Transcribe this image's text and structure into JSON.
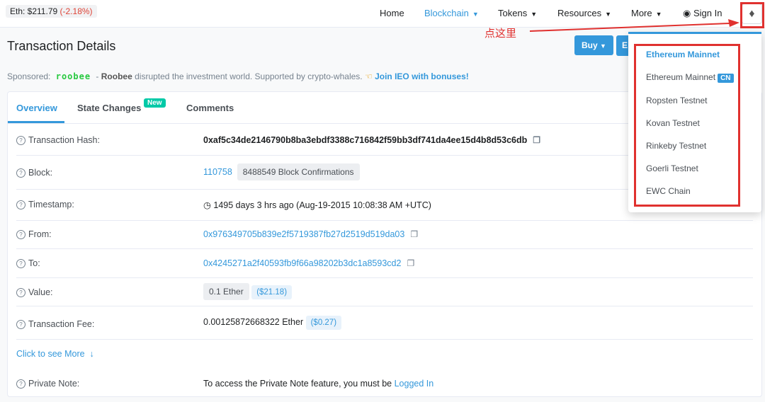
{
  "topbar": {
    "price_label": "Eth: $211.79",
    "price_change": "(-2.18%)",
    "nav": {
      "home": "Home",
      "blockchain": "Blockchain",
      "tokens": "Tokens",
      "resources": "Resources",
      "more": "More",
      "signin": "Sign In"
    }
  },
  "annotation": {
    "text": "点这里"
  },
  "header": {
    "title": "Transaction Details",
    "buy": "Buy",
    "ex": "E"
  },
  "sponsored": {
    "label": "Sponsored:",
    "brand": "roobee",
    "dash": " - ",
    "bold": "Roobee",
    "text": " disrupted the investment world. Supported by crypto-whales.",
    "cta": "Join IEO with bonuses!"
  },
  "tabs": {
    "overview": "Overview",
    "state": "State Changes",
    "new": "New",
    "comments": "Comments"
  },
  "rows": {
    "hash": {
      "label": "Transaction Hash:",
      "value": "0xaf5c34de2146790b8ba3ebdf3388c716842f59bb3df741da4ee15d4b8d53c6db"
    },
    "block": {
      "label": "Block:",
      "value": "110758",
      "confirmations": "8488549 Block Confirmations"
    },
    "timestamp": {
      "label": "Timestamp:",
      "value": "1495 days 3 hrs ago (Aug-19-2015 10:08:38 AM +UTC)"
    },
    "from": {
      "label": "From:",
      "value": "0x976349705b839e2f5719387fb27d2519d519da03"
    },
    "to": {
      "label": "To:",
      "value": "0x4245271a2f40593fb9f66a98202b3dc1a8593cd2"
    },
    "value": {
      "label": "Value:",
      "value": "0.1 Ether",
      "usd": "($21.18)"
    },
    "fee": {
      "label": "Transaction Fee:",
      "value": "0.00125872668322 Ether",
      "usd": "($0.27)"
    },
    "private": {
      "label": "Private Note:",
      "text": "To access the Private Note feature, you must be ",
      "link": "Logged In"
    }
  },
  "see_more": "Click to see More",
  "dropdown": {
    "items": [
      "Ethereum Mainnet",
      "Ethereum Mainnet",
      "Ropsten Testnet",
      "Kovan Testnet",
      "Rinkeby Testnet",
      "Goerli Testnet",
      "EWC Chain"
    ],
    "cn": "CN"
  },
  "colors": {
    "accent": "#3498db",
    "negative": "#de4437",
    "annotation": "#e0312f",
    "badge": "#00c9a7"
  },
  "icons": {
    "question": "question-circle-icon",
    "copy": "copy-icon",
    "clock": "clock-icon",
    "arrow": "arrow-down-icon",
    "user": "user-circle-icon",
    "eth": "ethereum-icon"
  }
}
